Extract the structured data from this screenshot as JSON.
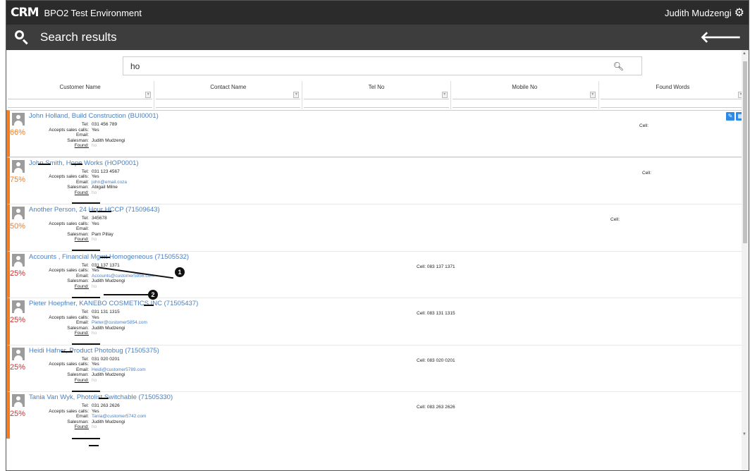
{
  "topbar": {
    "logo": "CRM",
    "app_title": "BPO2 Test Environment",
    "user_name": "Judith Mudzengi",
    "gear_icon": "gear-icon"
  },
  "header": {
    "title": "Search results",
    "back_icon": "arrow-left-icon"
  },
  "search": {
    "value": "ho",
    "icon": "search-icon"
  },
  "columns": [
    "Customer Name",
    "Contact Name",
    "Tel No",
    "Mobile No",
    "Found Words"
  ],
  "labels": {
    "tel": "Tel:",
    "accepts": "Accepts sales calls:",
    "email": "Email:",
    "salesman": "Salesman:",
    "found": "Found:",
    "cell": "Cell:"
  },
  "results": [
    {
      "title": "John Holland, Build Construction (BUI0001)",
      "score": "66%",
      "score_color": "#f57c20",
      "tel": "031 456 789",
      "accepts": "Yes",
      "email": "",
      "salesman": "Judith Mudzengi",
      "found": "ho",
      "cell": "",
      "selected": true
    },
    {
      "title": "John Smith, Hope Works (HOP0001)",
      "score": "75%",
      "score_color": "#f57c20",
      "tel": "031 123 4567",
      "accepts": "Yes",
      "email": "john@email.coza",
      "salesman": "Abigail Milne",
      "found": "ho",
      "cell": ""
    },
    {
      "title": "Another Person, 24 Hour HCCP (71509643)",
      "score": "50%",
      "score_color": "#f57c20",
      "tel": "345678",
      "accepts": "Yes",
      "email": "",
      "salesman": "Pam Pillay",
      "found": "ho",
      "cell": ""
    },
    {
      "title": "Accounts , Financial Mgmt Homogeneous (71505532)",
      "score": "25%",
      "score_color": "#d32f2f",
      "tel": "031 137 1371",
      "accepts": "Yes",
      "email": "Accounts@customer5956.com",
      "salesman": "Judith Mudzengi",
      "found": "ho",
      "cell": "083 137 1371"
    },
    {
      "title": "Pieter Hoepfner, KANEBO COSMETICS INC (71505437)",
      "score": "25%",
      "score_color": "#d32f2f",
      "tel": "031 131 1315",
      "accepts": "Yes",
      "email": "Pieter@customer5854.com",
      "salesman": "Judith Mudzengi",
      "found": "ho",
      "cell": "083 131 1315"
    },
    {
      "title": "Heidi Hafner, Product Photobug (71505375)",
      "score": "25%",
      "score_color": "#d32f2f",
      "tel": "031 020 0201",
      "accepts": "Yes",
      "email": "Heidi@customer5789.com",
      "salesman": "Judith Mudzengi",
      "found": "ho",
      "cell": "083 020 0201"
    },
    {
      "title": "Tania Van Wyk, Photolist Switchable (71505330)",
      "score": "25%",
      "score_color": "#d32f2f",
      "tel": "031 263 2626",
      "accepts": "Yes",
      "email": "Tania@customer5742.com",
      "salesman": "Judith Mudzengi",
      "found": "ho",
      "cell": "083 263 2626"
    }
  ],
  "callouts": [
    "1",
    "2"
  ],
  "colors": {
    "accent": "#f57c20",
    "link": "#4a7fc1",
    "header_bg": "#2b2b2b",
    "action_blue": "#2d8ae8"
  }
}
